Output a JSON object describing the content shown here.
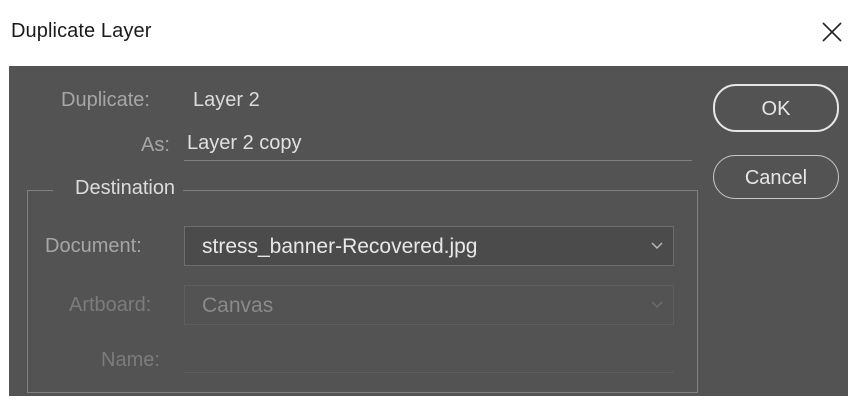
{
  "dialog": {
    "title": "Duplicate Layer",
    "close_label": "close"
  },
  "source": {
    "duplicate_label": "Duplicate:",
    "duplicate_value": "Layer 2",
    "as_label": "As:",
    "as_value": "Layer 2 copy"
  },
  "buttons": {
    "ok_label": "OK",
    "cancel_label": "Cancel"
  },
  "destination": {
    "legend": "Destination",
    "document_label": "Document:",
    "document_value": "stress_banner-Recovered.jpg",
    "artboard_label": "Artboard:",
    "artboard_value": "Canvas",
    "name_label": "Name:",
    "name_value": ""
  },
  "colors": {
    "panel_bg": "#535353",
    "text_primary": "#dcdcdc",
    "text_label": "#a6a6a6",
    "text_disabled": "#7c7c7c"
  }
}
